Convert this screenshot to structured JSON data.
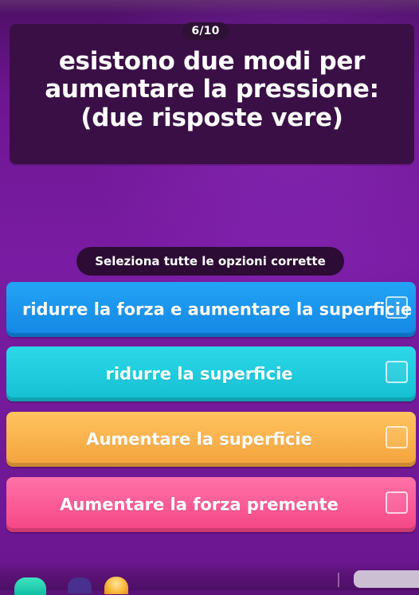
{
  "header": {
    "counter": "6/10"
  },
  "question": {
    "text": "esistono due modi per aumentare la pressione: (due risposte vere)"
  },
  "instruction": {
    "text": "Seleziona tutte le opzioni corrette"
  },
  "options": [
    {
      "label": "ridurre la forza e aumentare la superficie",
      "color": "#1a94ec"
    },
    {
      "label": "ridurre la superficie",
      "color": "#1ec9da"
    },
    {
      "label": "Aumentare la superficie",
      "color": "#f7b14a"
    },
    {
      "label": "Aumentare la forza premente",
      "color": "#f85c96"
    }
  ],
  "bottom_bar": {
    "icons": [
      "powerup-icon",
      "profile-icon",
      "reward-icon"
    ]
  }
}
